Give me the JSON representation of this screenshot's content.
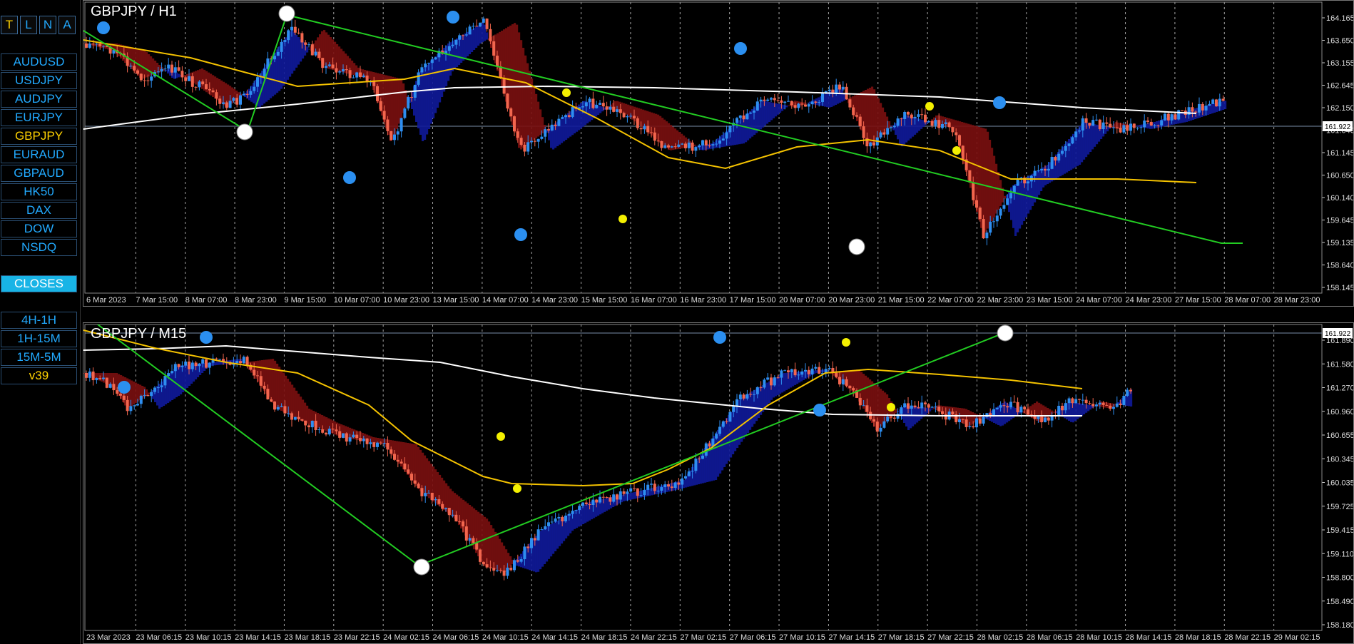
{
  "sidebar": {
    "top_buttons": [
      {
        "label": "T",
        "color": "#ffd200"
      },
      {
        "label": "L",
        "color": "#22aaff"
      },
      {
        "label": "N",
        "color": "#22aaff"
      },
      {
        "label": "A",
        "color": "#22aaff"
      }
    ],
    "symbols": [
      "AUDUSD",
      "USDJPY",
      "AUDJPY",
      "EURJPY",
      "GBPJPY",
      "EURAUD",
      "GBPAUD",
      "HK50",
      "DAX",
      "DOW",
      "NSDQ"
    ],
    "active_symbol": "GBPJPY",
    "closes_label": "CLOSES",
    "timeframe_buttons": [
      "4H-1H",
      "1H-15M",
      "15M-5M"
    ],
    "version": "v39"
  },
  "colors": {
    "bull": "#2e8ef0",
    "bear": "#f2664e",
    "ema_fast_cloud_bull": "#101a9a",
    "ema_fast_cloud_bear": "#7a1010",
    "ma_yellow": "#f4c200",
    "ma_white": "#ffffff",
    "trend_line": "#22cc22",
    "dot_blue": "#2b8ff0",
    "dot_yellow": "#f4f000",
    "grid": "#cccccc"
  },
  "charts": [
    {
      "title": "GBPJPY / H1",
      "price_label": "161.922",
      "y_labels": [
        "164.165",
        "163.650",
        "163.155",
        "162.645",
        "162.150",
        "161.640",
        "161.145",
        "160.650",
        "160.140",
        "159.645",
        "159.135",
        "158.640",
        "158.145"
      ],
      "x_labels": [
        "6 Mar 2023",
        "7 Mar 15:00",
        "8 Mar 07:00",
        "8 Mar 23:00",
        "9 Mar 15:00",
        "10 Mar 07:00",
        "10 Mar 23:00",
        "13 Mar 15:00",
        "14 Mar 07:00",
        "14 Mar 23:00",
        "15 Mar 15:00",
        "16 Mar 07:00",
        "16 Mar 23:00",
        "17 Mar 15:00",
        "20 Mar 07:00",
        "20 Mar 23:00",
        "21 Mar 15:00",
        "22 Mar 07:00",
        "22 Mar 23:00",
        "23 Mar 15:00",
        "24 Mar 07:00",
        "24 Mar 23:00",
        "27 Mar 15:00",
        "28 Mar 07:00",
        "28 Mar 23:00"
      ]
    },
    {
      "title": "GBPJPY / M15",
      "price_label": "161.922",
      "y_labels": [
        "161.890",
        "161.580",
        "161.270",
        "160.960",
        "160.655",
        "160.345",
        "160.035",
        "159.725",
        "159.415",
        "159.110",
        "158.800",
        "158.490",
        "158.180"
      ],
      "x_labels": [
        "23 Mar 2023",
        "23 Mar 06:15",
        "23 Mar 10:15",
        "23 Mar 14:15",
        "23 Mar 18:15",
        "23 Mar 22:15",
        "24 Mar 02:15",
        "24 Mar 06:15",
        "24 Mar 10:15",
        "24 Mar 14:15",
        "24 Mar 18:15",
        "24 Mar 22:15",
        "27 Mar 02:15",
        "27 Mar 06:15",
        "27 Mar 10:15",
        "27 Mar 14:15",
        "27 Mar 18:15",
        "27 Mar 22:15",
        "28 Mar 02:15",
        "28 Mar 06:15",
        "28 Mar 10:15",
        "28 Mar 14:15",
        "28 Mar 18:15",
        "28 Mar 22:15",
        "29 Mar 02:15"
      ]
    }
  ]
}
